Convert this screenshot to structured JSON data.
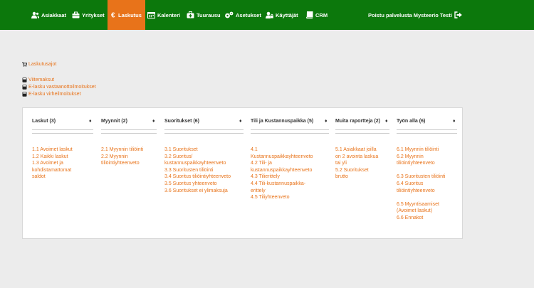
{
  "nav": {
    "items": [
      {
        "label": "Asiakkaat",
        "icon": "users-icon"
      },
      {
        "label": "Yritykset",
        "icon": "briefcase-icon"
      },
      {
        "label": "Laskutus",
        "icon": "euro-icon",
        "active": true
      },
      {
        "label": "Kalenteri",
        "icon": "calendar-icon"
      },
      {
        "label": "Tuurausu",
        "icon": "medkit-icon"
      },
      {
        "label": "Asetukset",
        "icon": "gears-icon"
      },
      {
        "label": "Käyttäjät",
        "icon": "user-lock-icon"
      },
      {
        "label": "CRM",
        "icon": "book-icon"
      }
    ],
    "logout_label": "Poistu palvelusta Mysteerio Testi"
  },
  "links": {
    "billing_runs": "Laskutusajot",
    "late_fees": "Viitemaksut",
    "einvoice_receipts": "E-lasku vastaanottoilmoitukset",
    "einvoice_errors": "E-lasku virheilmoitukset"
  },
  "columns": [
    {
      "header": "Laskut (3)",
      "items": [
        "1.1 Avoimet laskut",
        "1.2 Kaikki laskut",
        "1.3 Avoimet ja",
        "kohdistamattomat",
        "saldot"
      ]
    },
    {
      "header": "Myynnit (2)",
      "items": [
        "2.1 Myynnin tiliöinti",
        "2.2 Myynnin",
        "tiliöintiyhteenveto"
      ]
    },
    {
      "header": "Suoritukset (6)",
      "items": [
        "3.1 Suoritukset",
        "3.2 Suoritus/",
        "kustannuspaikkayhteenveto",
        "3.3 Suoritusten tiliöinti",
        "3.4 Suoritus tiliöintiyhteenveto",
        "3.5 Suoritus yhteenveto",
        "3.6 Suoritukset ei ylimaksuja"
      ]
    },
    {
      "header": "Tili ja Kustannuspaikka (5)",
      "items": [
        "4.1",
        "Kustannuspaikkayhteenveto",
        "4.2 Tili- ja",
        "kustannuspaikkayhteenveto",
        "4.3 Tilierittely",
        "4.4 Tili-kustannuspaikka-",
        "erittely",
        "4.5 Tiliyhteenveto"
      ]
    },
    {
      "header": "Muita raportteja (2)",
      "items": [
        "5.1 Asiakkaat joilla",
        "on 2 avointa laskua",
        "tai yli",
        "5.2 Suoritukset",
        "brutto"
      ]
    },
    {
      "header": "Työn alla (6)",
      "items": [
        "6.1 Myynnin tiliöinti",
        "6.2 Myynnin",
        "tiliöintiyhteenveto",
        "",
        "6.3 Suoritusten tiliöinti",
        "6.4 Suoritus",
        "tiliöintiyhteenveto",
        "",
        "6.5 Myyntisaamiset",
        "(Avoimet laskut)",
        "6.6 Ennakot"
      ]
    }
  ],
  "colors": {
    "nav_bg": "#0c780c",
    "active_bg": "#e8731a",
    "link": "#e8731a"
  }
}
